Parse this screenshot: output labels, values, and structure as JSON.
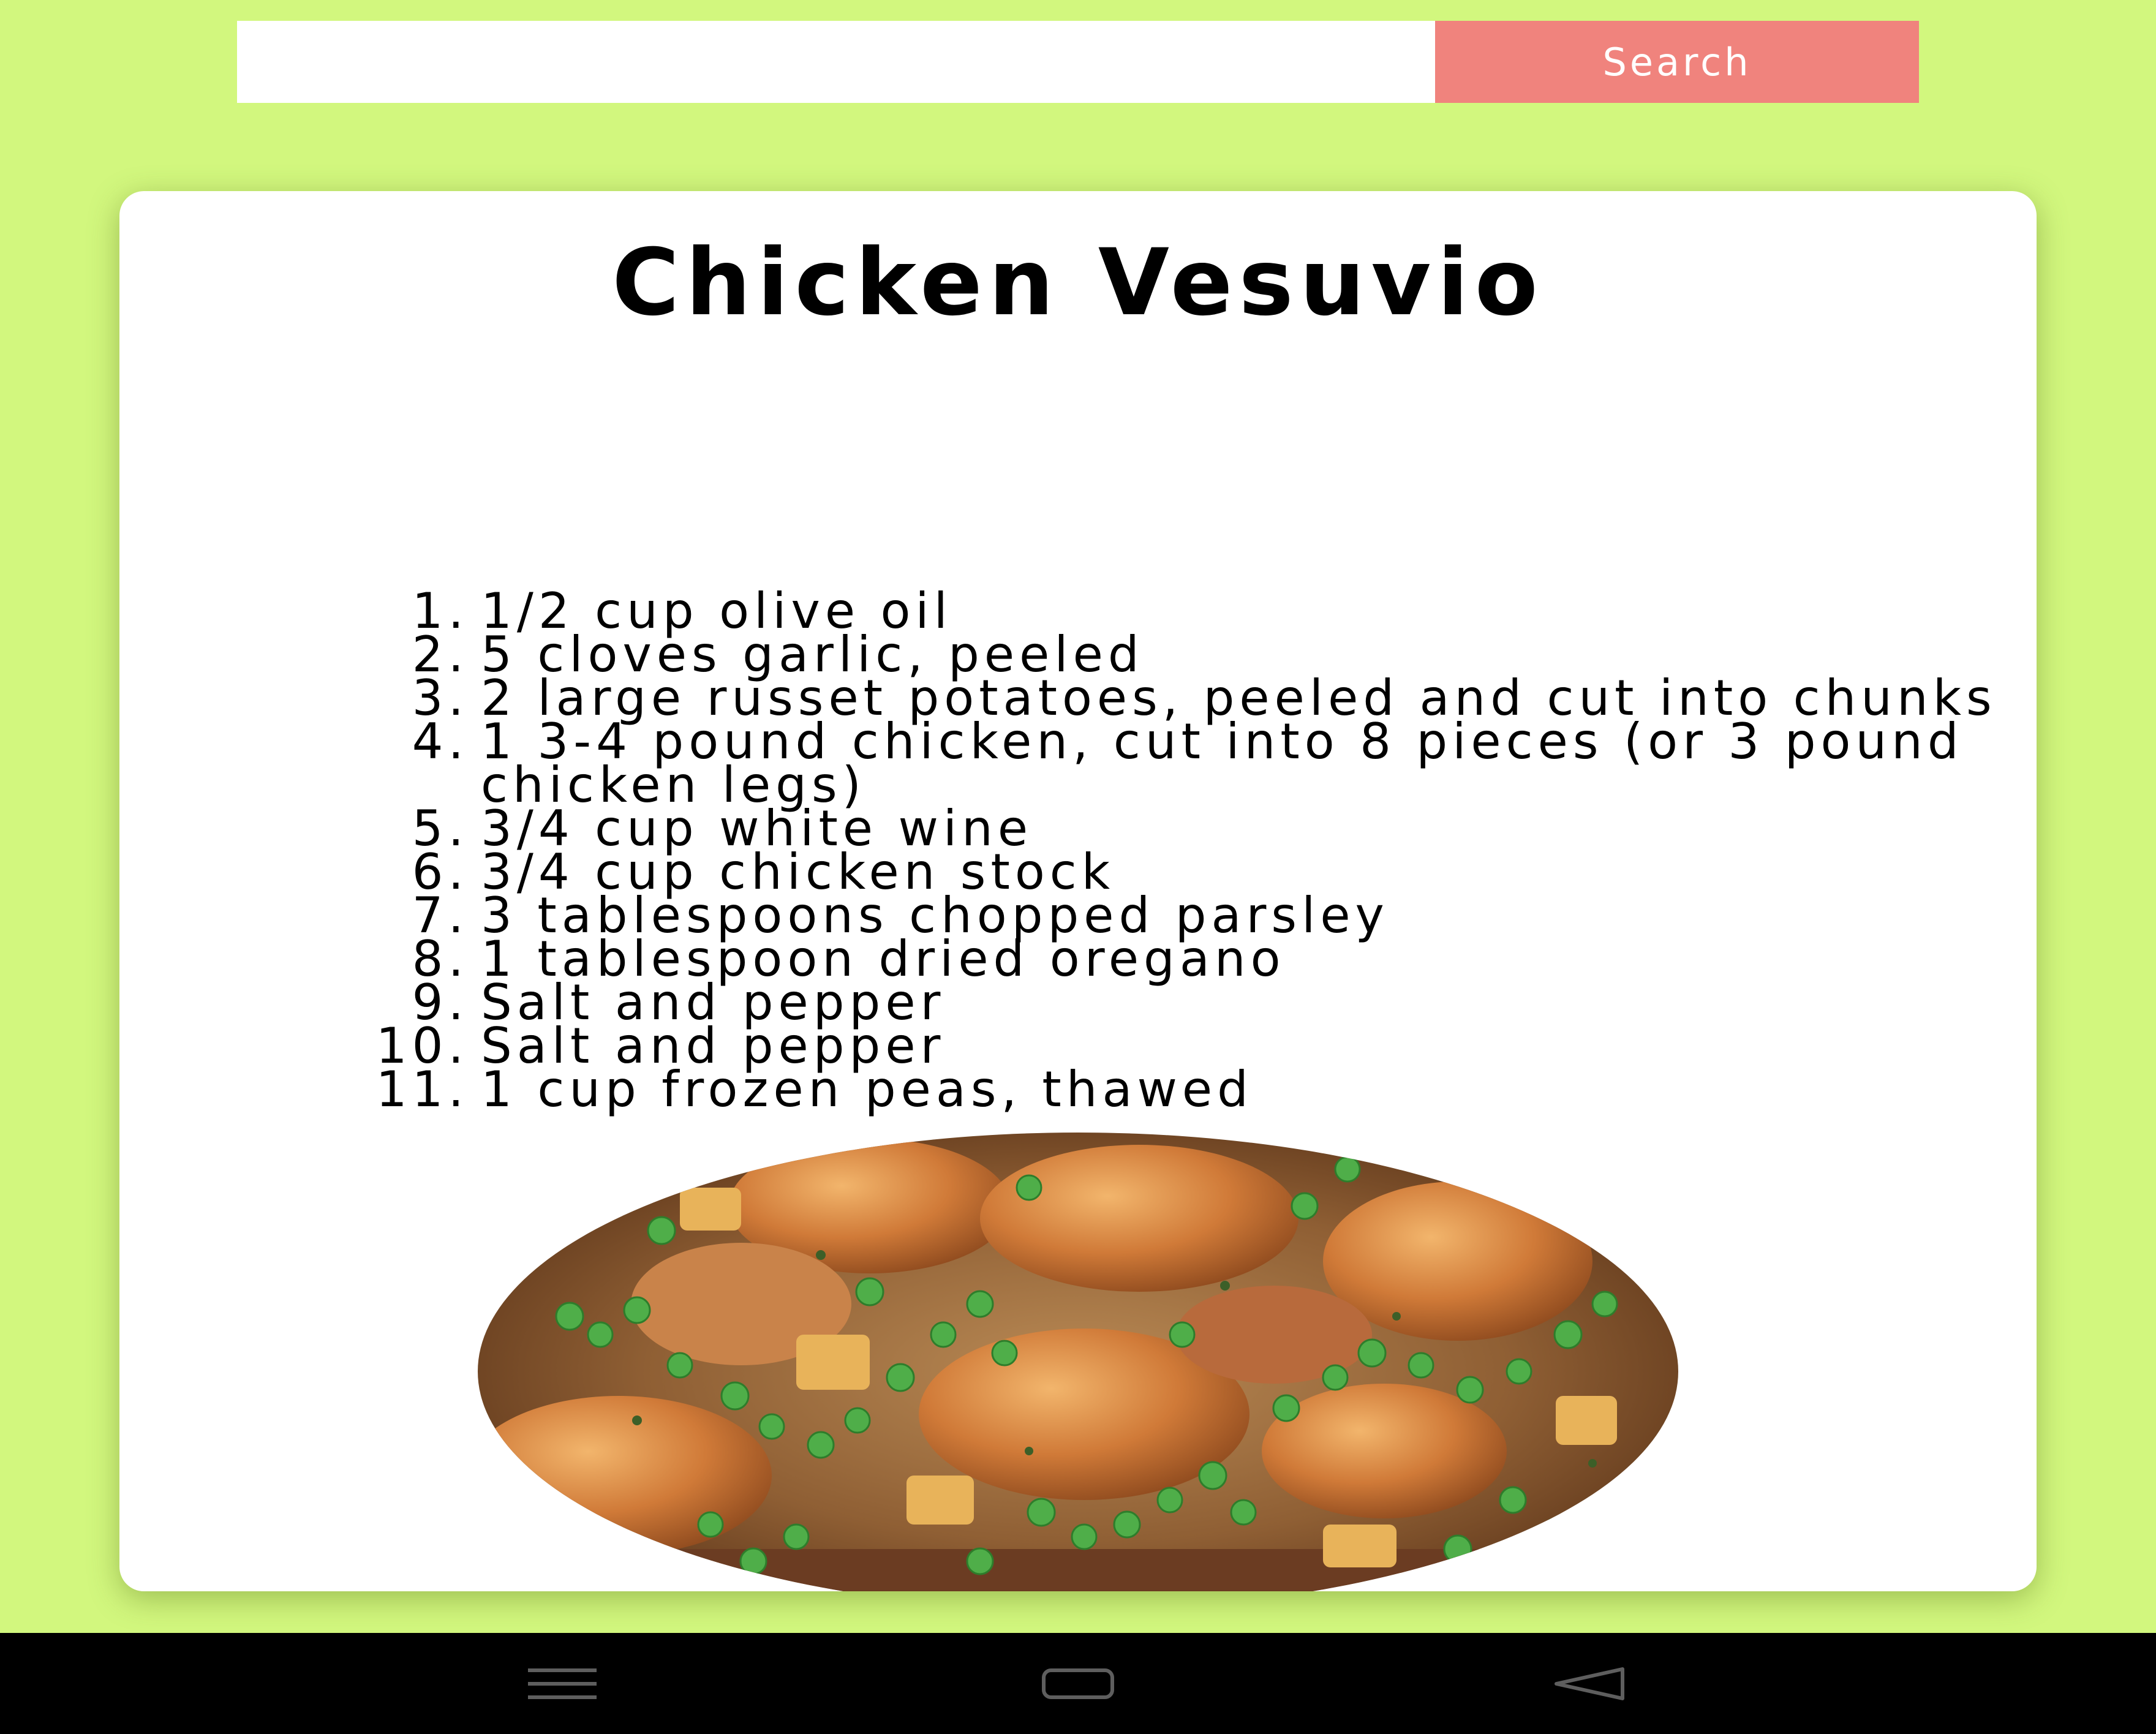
{
  "search": {
    "value": "",
    "placeholder": "",
    "button_label": "Search"
  },
  "recipe": {
    "title": "Chicken Vesuvio",
    "ingredients": [
      {
        "num": "1.",
        "text": "1/2 cup olive oil"
      },
      {
        "num": "2.",
        "text": "5 cloves garlic, peeled"
      },
      {
        "num": "3.",
        "text": "2 large russet potatoes, peeled and cut into chunks"
      },
      {
        "num": "4.",
        "text": "1 3-4 pound chicken, cut into 8 pieces (or 3 pound chicken legs)"
      },
      {
        "num": "5.",
        "text": "3/4 cup white wine"
      },
      {
        "num": "6.",
        "text": "3/4 cup chicken stock"
      },
      {
        "num": "7.",
        "text": "3 tablespoons chopped parsley"
      },
      {
        "num": "8.",
        "text": "1 tablespoon dried oregano"
      },
      {
        "num": "9.",
        "text": "Salt and pepper"
      },
      {
        "num": "10.",
        "text": "Salt and pepper"
      },
      {
        "num": "11.",
        "text": "1 cup frozen peas, thawed"
      }
    ],
    "number": "4228.043058200812"
  },
  "colors": {
    "background": "#d2f77e",
    "search_button": "#f0837d",
    "card": "#ffffff",
    "nav_bar": "#000000"
  },
  "icons": {
    "nav_menu": "menu-icon",
    "nav_home": "home-icon",
    "nav_back": "back-icon"
  }
}
